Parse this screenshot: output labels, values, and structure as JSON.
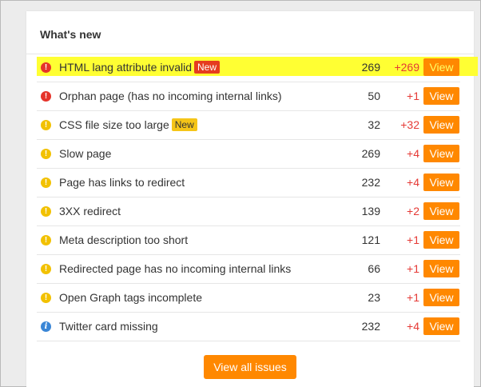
{
  "panel": {
    "title": "What's new",
    "view_all_label": "View all issues"
  },
  "colors": {
    "highlight": "#ffff33",
    "accent_orange": "#ff8800",
    "error_red": "#e5332a",
    "warning_yellow": "#f2c100",
    "notice_blue": "#3a86d6",
    "delta_red": "#e53935"
  },
  "issues": [
    {
      "icon": "error-icon",
      "label": "HTML lang attribute invalid",
      "badge": "New",
      "badge_style": "red",
      "count": "269",
      "delta": "+269",
      "button": "View",
      "highlighted": true
    },
    {
      "icon": "error-icon",
      "label": "Orphan page (has no incoming internal links)",
      "badge": "",
      "badge_style": "",
      "count": "50",
      "delta": "+1",
      "button": "View",
      "highlighted": false
    },
    {
      "icon": "warning-icon",
      "label": "CSS file size too large",
      "badge": "New",
      "badge_style": "yellow",
      "count": "32",
      "delta": "+32",
      "button": "View",
      "highlighted": false
    },
    {
      "icon": "warning-icon",
      "label": "Slow page",
      "badge": "",
      "badge_style": "",
      "count": "269",
      "delta": "+4",
      "button": "View",
      "highlighted": false
    },
    {
      "icon": "warning-icon",
      "label": "Page has links to redirect",
      "badge": "",
      "badge_style": "",
      "count": "232",
      "delta": "+4",
      "button": "View",
      "highlighted": false
    },
    {
      "icon": "warning-icon",
      "label": "3XX redirect",
      "badge": "",
      "badge_style": "",
      "count": "139",
      "delta": "+2",
      "button": "View",
      "highlighted": false
    },
    {
      "icon": "warning-icon",
      "label": "Meta description too short",
      "badge": "",
      "badge_style": "",
      "count": "121",
      "delta": "+1",
      "button": "View",
      "highlighted": false
    },
    {
      "icon": "warning-icon",
      "label": "Redirected page has no incoming internal links",
      "badge": "",
      "badge_style": "",
      "count": "66",
      "delta": "+1",
      "button": "View",
      "highlighted": false
    },
    {
      "icon": "warning-icon",
      "label": "Open Graph tags incomplete",
      "badge": "",
      "badge_style": "",
      "count": "23",
      "delta": "+1",
      "button": "View",
      "highlighted": false
    },
    {
      "icon": "notice-icon",
      "label": "Twitter card missing",
      "badge": "",
      "badge_style": "",
      "count": "232",
      "delta": "+4",
      "button": "View",
      "highlighted": false
    }
  ]
}
